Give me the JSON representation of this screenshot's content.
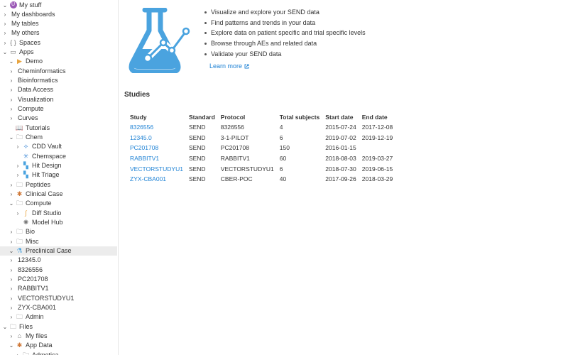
{
  "sidebar": {
    "items": [
      {
        "label": "My stuff",
        "arrow": "˅",
        "icon": "avatar",
        "glyph": "U",
        "depth": 0
      },
      {
        "label": "My dashboards",
        "arrow": "›",
        "icon": "",
        "glyph": "",
        "depth": 0
      },
      {
        "label": "My tables",
        "arrow": "›",
        "icon": "",
        "glyph": "",
        "depth": 0
      },
      {
        "label": "My others",
        "arrow": "›",
        "icon": "",
        "glyph": "",
        "depth": 0
      },
      {
        "label": "Spaces",
        "arrow": "›",
        "icon": "braces-icon",
        "glyph": "{ }",
        "depth": 0
      },
      {
        "label": "Apps",
        "arrow": "˅",
        "icon": "app-window-icon",
        "glyph": "▭",
        "depth": 0
      },
      {
        "label": "Demo",
        "arrow": "˅",
        "icon": "play-icon",
        "glyph": "▶",
        "depth": 1
      },
      {
        "label": "Cheminformatics",
        "arrow": "›",
        "icon": "",
        "glyph": "",
        "depth": 1
      },
      {
        "label": "Bioinformatics",
        "arrow": "›",
        "icon": "",
        "glyph": "",
        "depth": 1
      },
      {
        "label": "Data Access",
        "arrow": "›",
        "icon": "",
        "glyph": "",
        "depth": 1
      },
      {
        "label": "Visualization",
        "arrow": "›",
        "icon": "",
        "glyph": "",
        "depth": 1
      },
      {
        "label": "Compute",
        "arrow": "›",
        "icon": "",
        "glyph": "",
        "depth": 1
      },
      {
        "label": "Curves",
        "arrow": "›",
        "icon": "",
        "glyph": "",
        "depth": 1
      },
      {
        "label": "Tutorials",
        "arrow": "",
        "icon": "book-icon",
        "glyph": "📖",
        "depth": 1
      },
      {
        "label": "Chem",
        "arrow": "˅",
        "icon": "folder-icon",
        "glyph": "🗀",
        "depth": 1
      },
      {
        "label": "CDD Vault",
        "arrow": "›",
        "icon": "molecule-icon",
        "glyph": "⟡",
        "depth": 2
      },
      {
        "label": "Chemspace",
        "arrow": "",
        "icon": "chemspace-icon",
        "glyph": "✳",
        "depth": 2
      },
      {
        "label": "Hit Design",
        "arrow": "›",
        "icon": "hit-design-icon",
        "glyph": "▚",
        "depth": 2
      },
      {
        "label": "Hit Triage",
        "arrow": "›",
        "icon": "hit-triage-icon",
        "glyph": "▚",
        "depth": 2
      },
      {
        "label": "Peptides",
        "arrow": "›",
        "icon": "folder-icon",
        "glyph": "🗀",
        "depth": 1
      },
      {
        "label": "Clinical Case",
        "arrow": "›",
        "icon": "clinical-case-icon",
        "glyph": "✱",
        "depth": 1
      },
      {
        "label": "Compute",
        "arrow": "˅",
        "icon": "folder-icon",
        "glyph": "🗀",
        "depth": 1
      },
      {
        "label": "Diff Studio",
        "arrow": "›",
        "icon": "diff-studio-icon",
        "glyph": "∫",
        "depth": 2
      },
      {
        "label": "Model Hub",
        "arrow": "",
        "icon": "model-hub-icon",
        "glyph": "✺",
        "depth": 2
      },
      {
        "label": "Bio",
        "arrow": "›",
        "icon": "folder-icon",
        "glyph": "🗀",
        "depth": 1
      },
      {
        "label": "Misc",
        "arrow": "›",
        "icon": "folder-icon",
        "glyph": "🗀",
        "depth": 1
      },
      {
        "label": "Preclinical Case",
        "arrow": "˅",
        "icon": "preclinical-case-icon",
        "glyph": "⚗",
        "depth": 1
      },
      {
        "label": "12345.0",
        "arrow": "›",
        "icon": "",
        "glyph": "",
        "depth": 1
      },
      {
        "label": "8326556",
        "arrow": "›",
        "icon": "",
        "glyph": "",
        "depth": 1
      },
      {
        "label": "PC201708",
        "arrow": "›",
        "icon": "",
        "glyph": "",
        "depth": 1
      },
      {
        "label": "RABBITV1",
        "arrow": "›",
        "icon": "",
        "glyph": "",
        "depth": 1
      },
      {
        "label": "VECTORSTUDYU1",
        "arrow": "›",
        "icon": "",
        "glyph": "",
        "depth": 1
      },
      {
        "label": "ZYX-CBA001",
        "arrow": "›",
        "icon": "",
        "glyph": "",
        "depth": 1
      },
      {
        "label": "Admin",
        "arrow": "›",
        "icon": "folder-icon",
        "glyph": "🗀",
        "depth": 1
      },
      {
        "label": "Files",
        "arrow": "˅",
        "icon": "folder-icon",
        "glyph": "🗀",
        "depth": 0
      },
      {
        "label": "My files",
        "arrow": "›",
        "icon": "home-icon",
        "glyph": "⌂",
        "depth": 1
      },
      {
        "label": "App Data",
        "arrow": "˅",
        "icon": "app-data-icon",
        "glyph": "✱",
        "depth": 1
      },
      {
        "label": "Admetica",
        "arrow": "›",
        "icon": "folder-icon",
        "glyph": "🗀",
        "depth": 2
      }
    ],
    "selected_index": 26
  },
  "main": {
    "features": [
      "Visualize and explore your SEND data",
      "Find patterns and trends in your data",
      "Explore data on patient specific and trial specific levels",
      "Browse through AEs and related data",
      "Validate your SEND data"
    ],
    "learn_more": "Learn more",
    "studies_title": "Studies",
    "table": {
      "headers": [
        "Study",
        "Standard",
        "Protocol",
        "Total subjects",
        "Start date",
        "End date"
      ],
      "rows": [
        [
          "8326556",
          "SEND",
          "8326556",
          "4",
          "2015-07-24",
          "2017-12-08"
        ],
        [
          "12345.0",
          "SEND",
          "3-1-PILOT",
          "6",
          "2019-07-02",
          "2019-12-19"
        ],
        [
          "PC201708",
          "SEND",
          "PC201708",
          "150",
          "2016-01-15",
          ""
        ],
        [
          "RABBITV1",
          "SEND",
          "RABBITV1",
          "60",
          "2018-08-03",
          "2019-03-27"
        ],
        [
          "VECTORSTUDYU1",
          "SEND",
          "VECTORSTUDYU1",
          "6",
          "2018-07-30",
          "2019-06-15"
        ],
        [
          "ZYX-CBA001",
          "SEND",
          "CBER-POC",
          "40",
          "2017-09-26",
          "2018-03-29"
        ]
      ]
    }
  },
  "colors": {
    "accent": "#2083d5",
    "flask": "#4aa3df",
    "selected_row": "#ececec"
  }
}
